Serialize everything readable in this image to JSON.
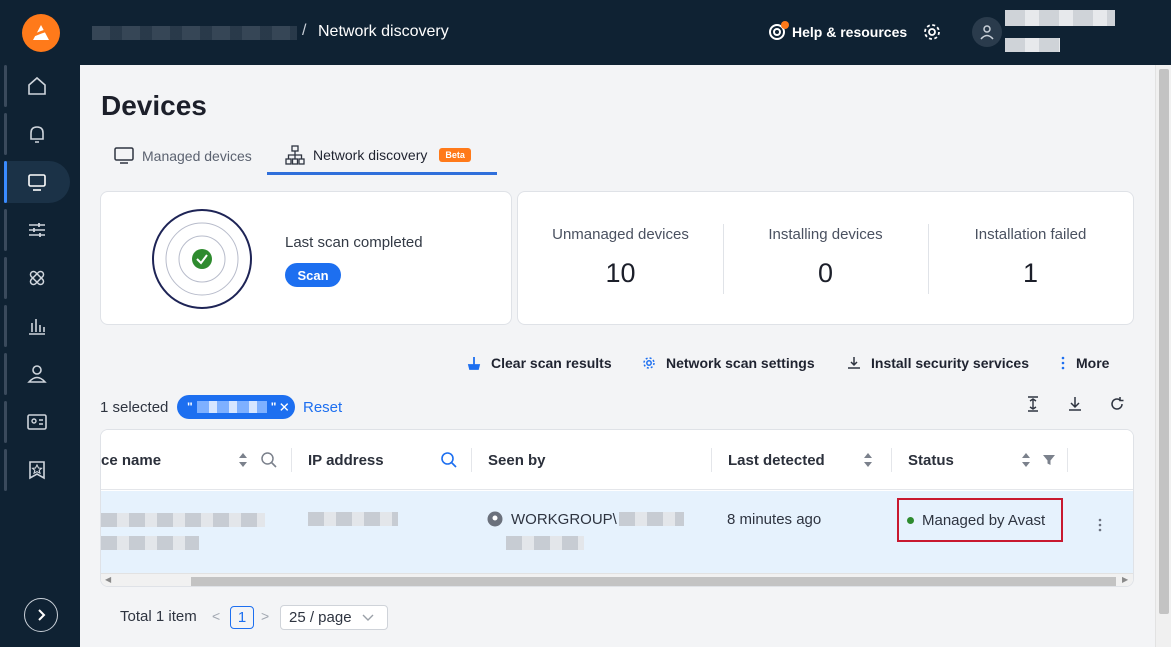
{
  "header": {
    "breadcrumb_current": "Network discovery",
    "breadcrumb_separator": "/",
    "help_label": "Help & resources"
  },
  "sidebar": {
    "items": [
      {
        "icon": "home-icon"
      },
      {
        "icon": "bell-icon"
      },
      {
        "icon": "monitor-icon",
        "active": true
      },
      {
        "icon": "sliders-icon"
      },
      {
        "icon": "bandage-icon"
      },
      {
        "icon": "bar-chart-icon"
      },
      {
        "icon": "user-icon"
      },
      {
        "icon": "id-card-icon"
      },
      {
        "icon": "star-badge-icon"
      }
    ]
  },
  "page": {
    "title": "Devices",
    "tabs": [
      {
        "label": "Managed devices"
      },
      {
        "label": "Network discovery",
        "badge": "Beta",
        "active": true
      }
    ]
  },
  "scan": {
    "status": "Last scan completed",
    "button": "Scan"
  },
  "stats": [
    {
      "label": "Unmanaged devices",
      "value": "10"
    },
    {
      "label": "Installing devices",
      "value": "0"
    },
    {
      "label": "Installation failed",
      "value": "1"
    }
  ],
  "actions": {
    "clear": "Clear scan results",
    "settings": "Network scan settings",
    "install": "Install security services",
    "more": "More"
  },
  "filter": {
    "selected": "1 selected",
    "chip_prefix": "\"",
    "chip_suffix": "\"",
    "reset": "Reset"
  },
  "table": {
    "columns": [
      "ce name",
      "IP address",
      "Seen by",
      "Last detected",
      "Status"
    ],
    "rows": [
      {
        "seen_by": "WORKGROUP\\",
        "last_detected": "8 minutes ago",
        "status": "Managed by Avast"
      }
    ]
  },
  "pagination": {
    "total": "Total 1 item",
    "page": "1",
    "per_page": "25 / page"
  },
  "colors": {
    "accent": "#1d6ff0",
    "brand": "#ff7a1a",
    "dark": "#0f2233",
    "highlight": "#c8192f"
  }
}
